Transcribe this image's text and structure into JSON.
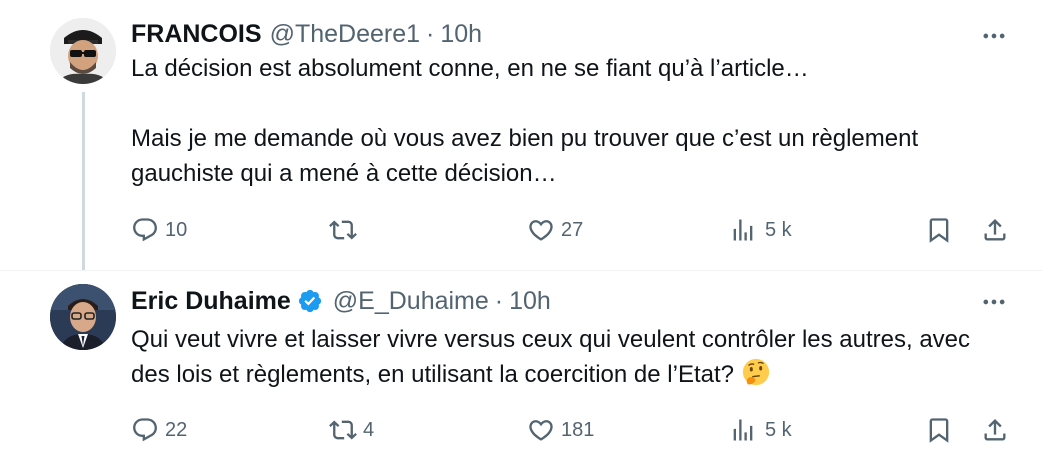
{
  "tweets": [
    {
      "name": "FRANCOIS",
      "handle": "@TheDeere1",
      "separator": "·",
      "time": "10h",
      "verified": false,
      "text": "La décision est absolument conne, en ne se fiant qu’à l’article…\n\nMais je me demande où vous avez bien pu trouver que c’est un règlement gauchiste qui a mené à cette décision…",
      "replies": "10",
      "retweets": "",
      "likes": "27",
      "views": "5 k"
    },
    {
      "name": "Eric Duhaime",
      "handle": "@E_Duhaime",
      "separator": "·",
      "time": "10h",
      "verified": true,
      "text": "Qui veut vivre et laisser vivre versus ceux qui veulent contrôler les autres, avec des lois et règlements, en utilisant la coercition de l’Etat?",
      "emoji": "thinking-face-emoji",
      "replies": "22",
      "retweets": "4",
      "likes": "181",
      "views": "5 k"
    }
  ],
  "colors": {
    "text": "#0f1419",
    "muted": "#536471",
    "verified": "#1d9bf0",
    "thread_line": "#cfd9de"
  }
}
